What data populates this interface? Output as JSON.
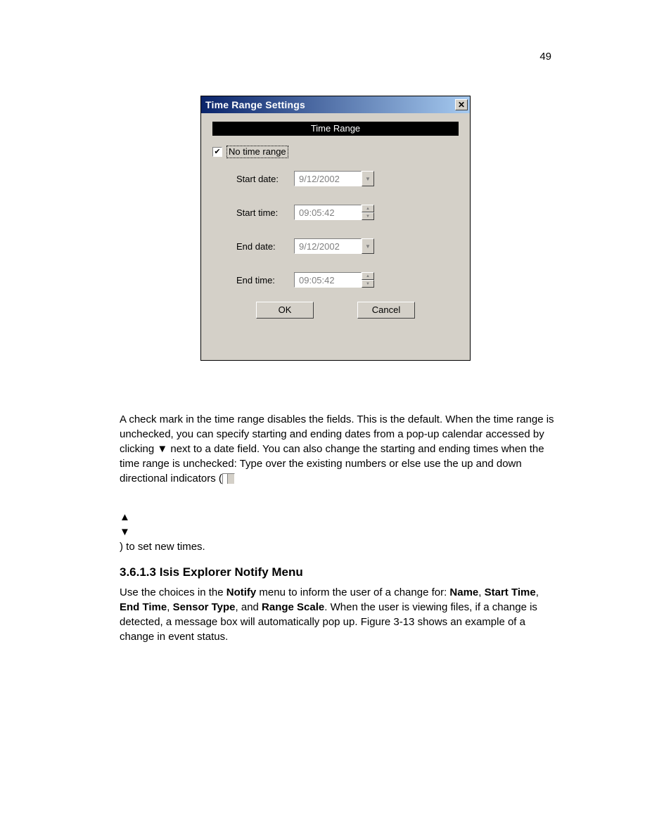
{
  "page_number": "49",
  "dialog": {
    "title": "Time Range Settings",
    "section_header": "Time Range",
    "no_time_range_label": "No time range",
    "no_time_range_checked": true,
    "fields": {
      "start_date": {
        "label": "Start date:",
        "value": "9/12/2002"
      },
      "start_time": {
        "label": "Start time:",
        "value": "09:05:42"
      },
      "end_date": {
        "label": "End date:",
        "value": "9/12/2002"
      },
      "end_time": {
        "label": "End time:",
        "value": "09:05:42"
      }
    },
    "buttons": {
      "ok": "OK",
      "cancel": "Cancel"
    }
  },
  "text": {
    "para1_a": "A check mark in the time range disables the fields. This is the default. When the time range is unchecked, you can specify starting and ending dates from a pop-up calendar accessed by clicking ▼ next to a date field. You can also change the starting and ending times when the time range is unchecked: Type over the existing numbers or else use the up and down directional indicators (",
    "para1_b": ") to set new times.",
    "heading": "3.6.1.3 Isis Explorer Notify Menu",
    "para2_a": "Use the choices in the ",
    "notify": "Notify",
    "para2_b": " menu to inform the user of a change for: ",
    "name": "Name",
    "start_time": "Start Time",
    "end_time": "End Time",
    "sensor_type": "Sensor Type",
    "and": ", and ",
    "range_scale": "Range Scale",
    "para2_c": ". When the user is viewing files, if a change is detected, a message box will automatically pop up. Figure 3-13 shows an example of a change in event status.",
    "sep": ", "
  }
}
